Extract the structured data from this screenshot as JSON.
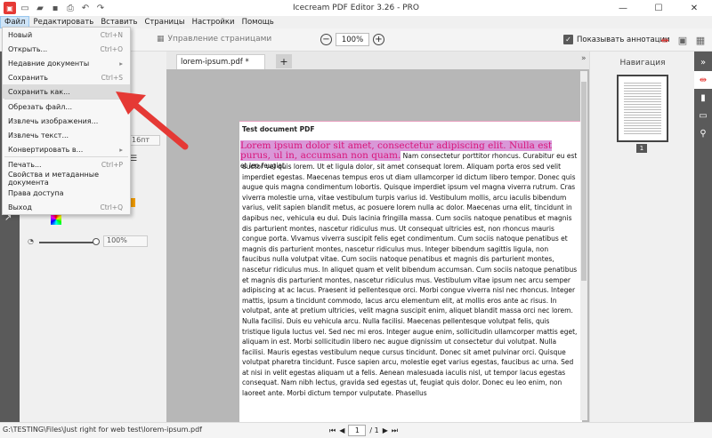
{
  "window": {
    "title": "Icecream PDF Editor 3.26 - PRO",
    "menu": [
      "Файл",
      "Редактировать",
      "Вставить",
      "Страницы",
      "Настройки",
      "Помощь"
    ],
    "controls": {
      "minimize": "—",
      "maximize": "☐",
      "close": "✕"
    }
  },
  "toolbar": {
    "manage_pages": "Управление страницами",
    "zoom": "100%",
    "zoom_in": "+",
    "zoom_out": "−",
    "show_annotations": "Показывать аннотации"
  },
  "file_menu": {
    "items": [
      {
        "label": "Новый",
        "shortcut": "Ctrl+N"
      },
      {
        "label": "Открыть...",
        "shortcut": "Ctrl+O"
      },
      {
        "label": "Недавние документы",
        "shortcut": "▸"
      },
      {
        "label": "Сохранить",
        "shortcut": "Ctrl+S"
      },
      {
        "label": "Сохранить как...",
        "shortcut": ""
      },
      {
        "label": "Обрезать файл...",
        "shortcut": ""
      },
      {
        "label": "Извлечь изображения...",
        "shortcut": ""
      },
      {
        "label": "Извлечь текст...",
        "shortcut": ""
      },
      {
        "label": "Конвертировать в...",
        "shortcut": "▸"
      },
      {
        "label": "Печать...",
        "shortcut": "Ctrl+P"
      },
      {
        "label": "Свойства и метаданные документа",
        "shortcut": ""
      },
      {
        "label": "Права доступа",
        "shortcut": ""
      },
      {
        "label": "Выход",
        "shortcut": "Ctrl+Q"
      }
    ]
  },
  "left_panel": {
    "font_size": "16пт",
    "opacity": "100%"
  },
  "tabs": {
    "active": "lorem-ipsum.pdf *",
    "add": "+"
  },
  "document": {
    "title": "Test document PDF",
    "highlighted": "Lorem ipsum dolor sit amet, consectetur adipiscing elit. Nulla est purus, ul in, accumsan non quam.",
    "highlight_tail": " Nam consectetur porttitor rhoncus. Curabitur eu est et leo feugiat",
    "body": "auctor vel quis lorem. Ut et ligula dolor, sit amet consequat lorem. Aliquam porta eros sed velit imperdiet egestas. Maecenas tempus eros ut diam ullamcorper id dictum libero tempor. Donec quis augue quis magna condimentum lobortis. Quisque imperdiet ipsum vel magna viverra rutrum. Cras viverra molestie urna, vitae vestibulum turpis varius id. Vestibulum mollis, arcu iaculis bibendum varius, velit sapien blandit metus, ac posuere lorem nulla ac dolor. Maecenas urna elit, tincidunt in dapibus nec, vehicula eu dui. Duis lacinia fringilla massa. Cum sociis natoque penatibus et magnis dis parturient montes, nascetur ridiculus mus. Ut consequat ultricies est, non rhoncus mauris congue porta. Vivamus viverra suscipit felis eget condimentum. Cum sociis natoque penatibus et magnis dis parturient montes, nascetur ridiculus mus. Integer bibendum sagittis ligula, non faucibus nulla volutpat vitae. Cum sociis natoque penatibus et magnis dis parturient montes, nascetur ridiculus mus. In aliquet quam et velit bibendum accumsan. Cum sociis natoque penatibus et magnis dis parturient montes, nascetur ridiculus mus. Vestibulum vitae ipsum nec arcu semper adipiscing at ac lacus. Praesent id pellentesque orci. Morbi congue viverra nisl nec rhoncus. Integer mattis, ipsum a tincidunt commodo, lacus arcu elementum elit, at mollis eros ante ac risus. In volutpat, ante at pretium ultricies, velit magna suscipit enim, aliquet blandit massa orci nec lorem. Nulla facilisi. Duis eu vehicula arcu. Nulla facilisi. Maecenas pellentesque volutpat felis, quis tristique ligula luctus vel. Sed nec mi eros. Integer augue enim, sollicitudin ullamcorper mattis eget, aliquam in est. Morbi sollicitudin libero nec augue dignissim ut consectetur dui volutpat. Nulla facilisi. Mauris egestas vestibulum neque cursus tincidunt. Donec sit amet pulvinar orci. Quisque volutpat pharetra tincidunt. Fusce sapien arcu, molestie eget varius egestas, faucibus ac urna. Sed at nisi in velit egestas aliquam ut a felis. Aenean malesuada iaculis nisl, ut tempor lacus egestas consequat. Nam nibh lectus, gravida sed egestas ut, feugiat quis dolor. Donec eu leo enim, non laoreet ante. Morbi dictum tempor vulputate. Phasellus"
  },
  "navigation": {
    "title": "Навигация",
    "page_badge": "1"
  },
  "status": {
    "path": "G:\\TESTING\\Files\\Just right for web test\\lorem-ipsum.pdf",
    "page": "1",
    "total": "/ 1"
  },
  "colors": {
    "accent": "#e53935",
    "highlight": "#d998d8",
    "highlight_text": "#d9147a",
    "dark_strip": "#5a5a5a"
  }
}
